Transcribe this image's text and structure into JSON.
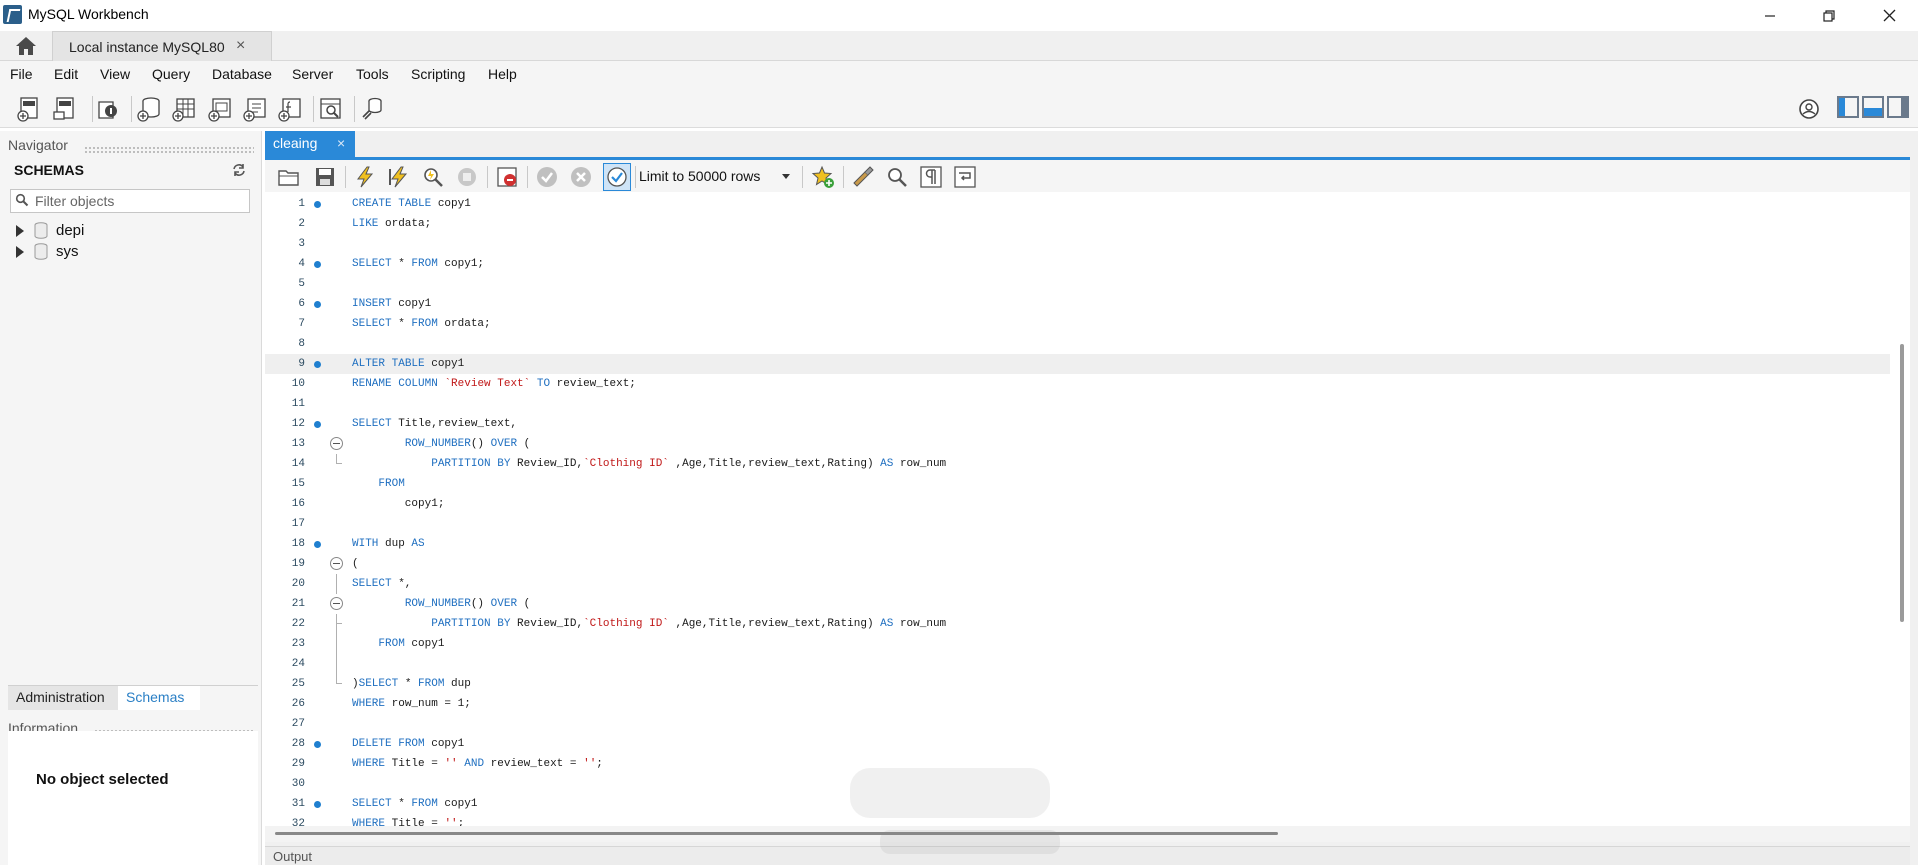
{
  "window": {
    "title": "MySQL Workbench"
  },
  "connection_tab": {
    "label": "Local instance MySQL80",
    "close": "×"
  },
  "menu": {
    "items": [
      "File",
      "Edit",
      "View",
      "Query",
      "Database",
      "Server",
      "Tools",
      "Scripting",
      "Help"
    ]
  },
  "navigator": {
    "header": "Navigator",
    "schemas_title": "SCHEMAS",
    "filter_placeholder": "Filter objects",
    "schemas": [
      "depi",
      "sys"
    ],
    "tabs": [
      "Administration",
      "Schemas"
    ],
    "info_header": "Information",
    "info_text": "No object selected"
  },
  "editor": {
    "tab": {
      "label": "cleaing",
      "close": "×"
    },
    "limit_label": "Limit to 50000 rows",
    "current_line": 9,
    "lines": [
      {
        "n": "1",
        "code": "CREATE TABLE copy1",
        "bp": true
      },
      {
        "n": "2",
        "code": "LIKE ordata;"
      },
      {
        "n": "3",
        "code": ""
      },
      {
        "n": "4",
        "code": "SELECT * FROM copy1;",
        "bp": true
      },
      {
        "n": "5",
        "code": ""
      },
      {
        "n": "6",
        "code": "INSERT copy1",
        "bp": true
      },
      {
        "n": "7",
        "code": "SELECT * FROM ordata;"
      },
      {
        "n": "8",
        "code": ""
      },
      {
        "n": "9",
        "code": "ALTER TABLE copy1",
        "bp": true
      },
      {
        "n": "10",
        "code": "RENAME COLUMN `Review Text` TO review_text;"
      },
      {
        "n": "11",
        "code": ""
      },
      {
        "n": "12",
        "code": "SELECT Title,review_text,",
        "bp": true
      },
      {
        "n": "13",
        "code": "        ROW_NUMBER() OVER (",
        "fold": "start"
      },
      {
        "n": "14",
        "code": "            PARTITION BY Review_ID,`Clothing ID` ,Age,Title,review_text,Rating) AS row_num",
        "fold": "end"
      },
      {
        "n": "15",
        "code": "    FROM"
      },
      {
        "n": "16",
        "code": "        copy1;"
      },
      {
        "n": "17",
        "code": ""
      },
      {
        "n": "18",
        "code": "WITH dup AS",
        "bp": true
      },
      {
        "n": "19",
        "code": "(",
        "fold": "start"
      },
      {
        "n": "20",
        "code": "SELECT *,",
        "fold": "mid"
      },
      {
        "n": "21",
        "code": "        ROW_NUMBER() OVER (",
        "fold": "start"
      },
      {
        "n": "22",
        "code": "            PARTITION BY Review_ID,`Clothing ID` ,Age,Title,review_text,Rating) AS row_num",
        "fold": "inner-end"
      },
      {
        "n": "23",
        "code": "    FROM copy1",
        "fold": "mid"
      },
      {
        "n": "24",
        "code": "",
        "fold": "mid"
      },
      {
        "n": "25",
        "code": ")SELECT * FROM dup",
        "fold": "end"
      },
      {
        "n": "26",
        "code": "WHERE row_num = 1;"
      },
      {
        "n": "27",
        "code": ""
      },
      {
        "n": "28",
        "code": "DELETE FROM copy1",
        "bp": true
      },
      {
        "n": "29",
        "code": "WHERE Title = '' AND review_text = '';"
      },
      {
        "n": "30",
        "code": ""
      },
      {
        "n": "31",
        "code": "SELECT * FROM copy1",
        "bp": true
      },
      {
        "n": "32",
        "code": "WHERE Title = '';"
      }
    ]
  },
  "output_label": "Output",
  "colors": {
    "accent": "#2a89d8",
    "keyword": "#1f6fc0",
    "string": "#c01818",
    "breakpoint": "#1f7fcf"
  },
  "icons": [
    "home-icon",
    "new-sql-tab-icon",
    "open-sql-script-icon",
    "inspector-icon",
    "create-schema-icon",
    "create-table-icon",
    "create-view-icon",
    "create-procedure-icon",
    "create-function-icon",
    "search-table-data-icon",
    "reconnect-icon",
    "folder-open-icon",
    "save-icon",
    "execute-icon",
    "execute-statement-icon",
    "explain-icon",
    "stop-icon",
    "toggle-error-stop-icon",
    "commit-icon",
    "rollback-icon",
    "autocommit-icon",
    "bookmark-icon",
    "beautify-icon",
    "find-icon",
    "invisible-chars-icon",
    "word-wrap-icon",
    "refresh-icon",
    "search-icon",
    "database-icon",
    "close-icon",
    "minimize-icon",
    "maximize-icon"
  ]
}
